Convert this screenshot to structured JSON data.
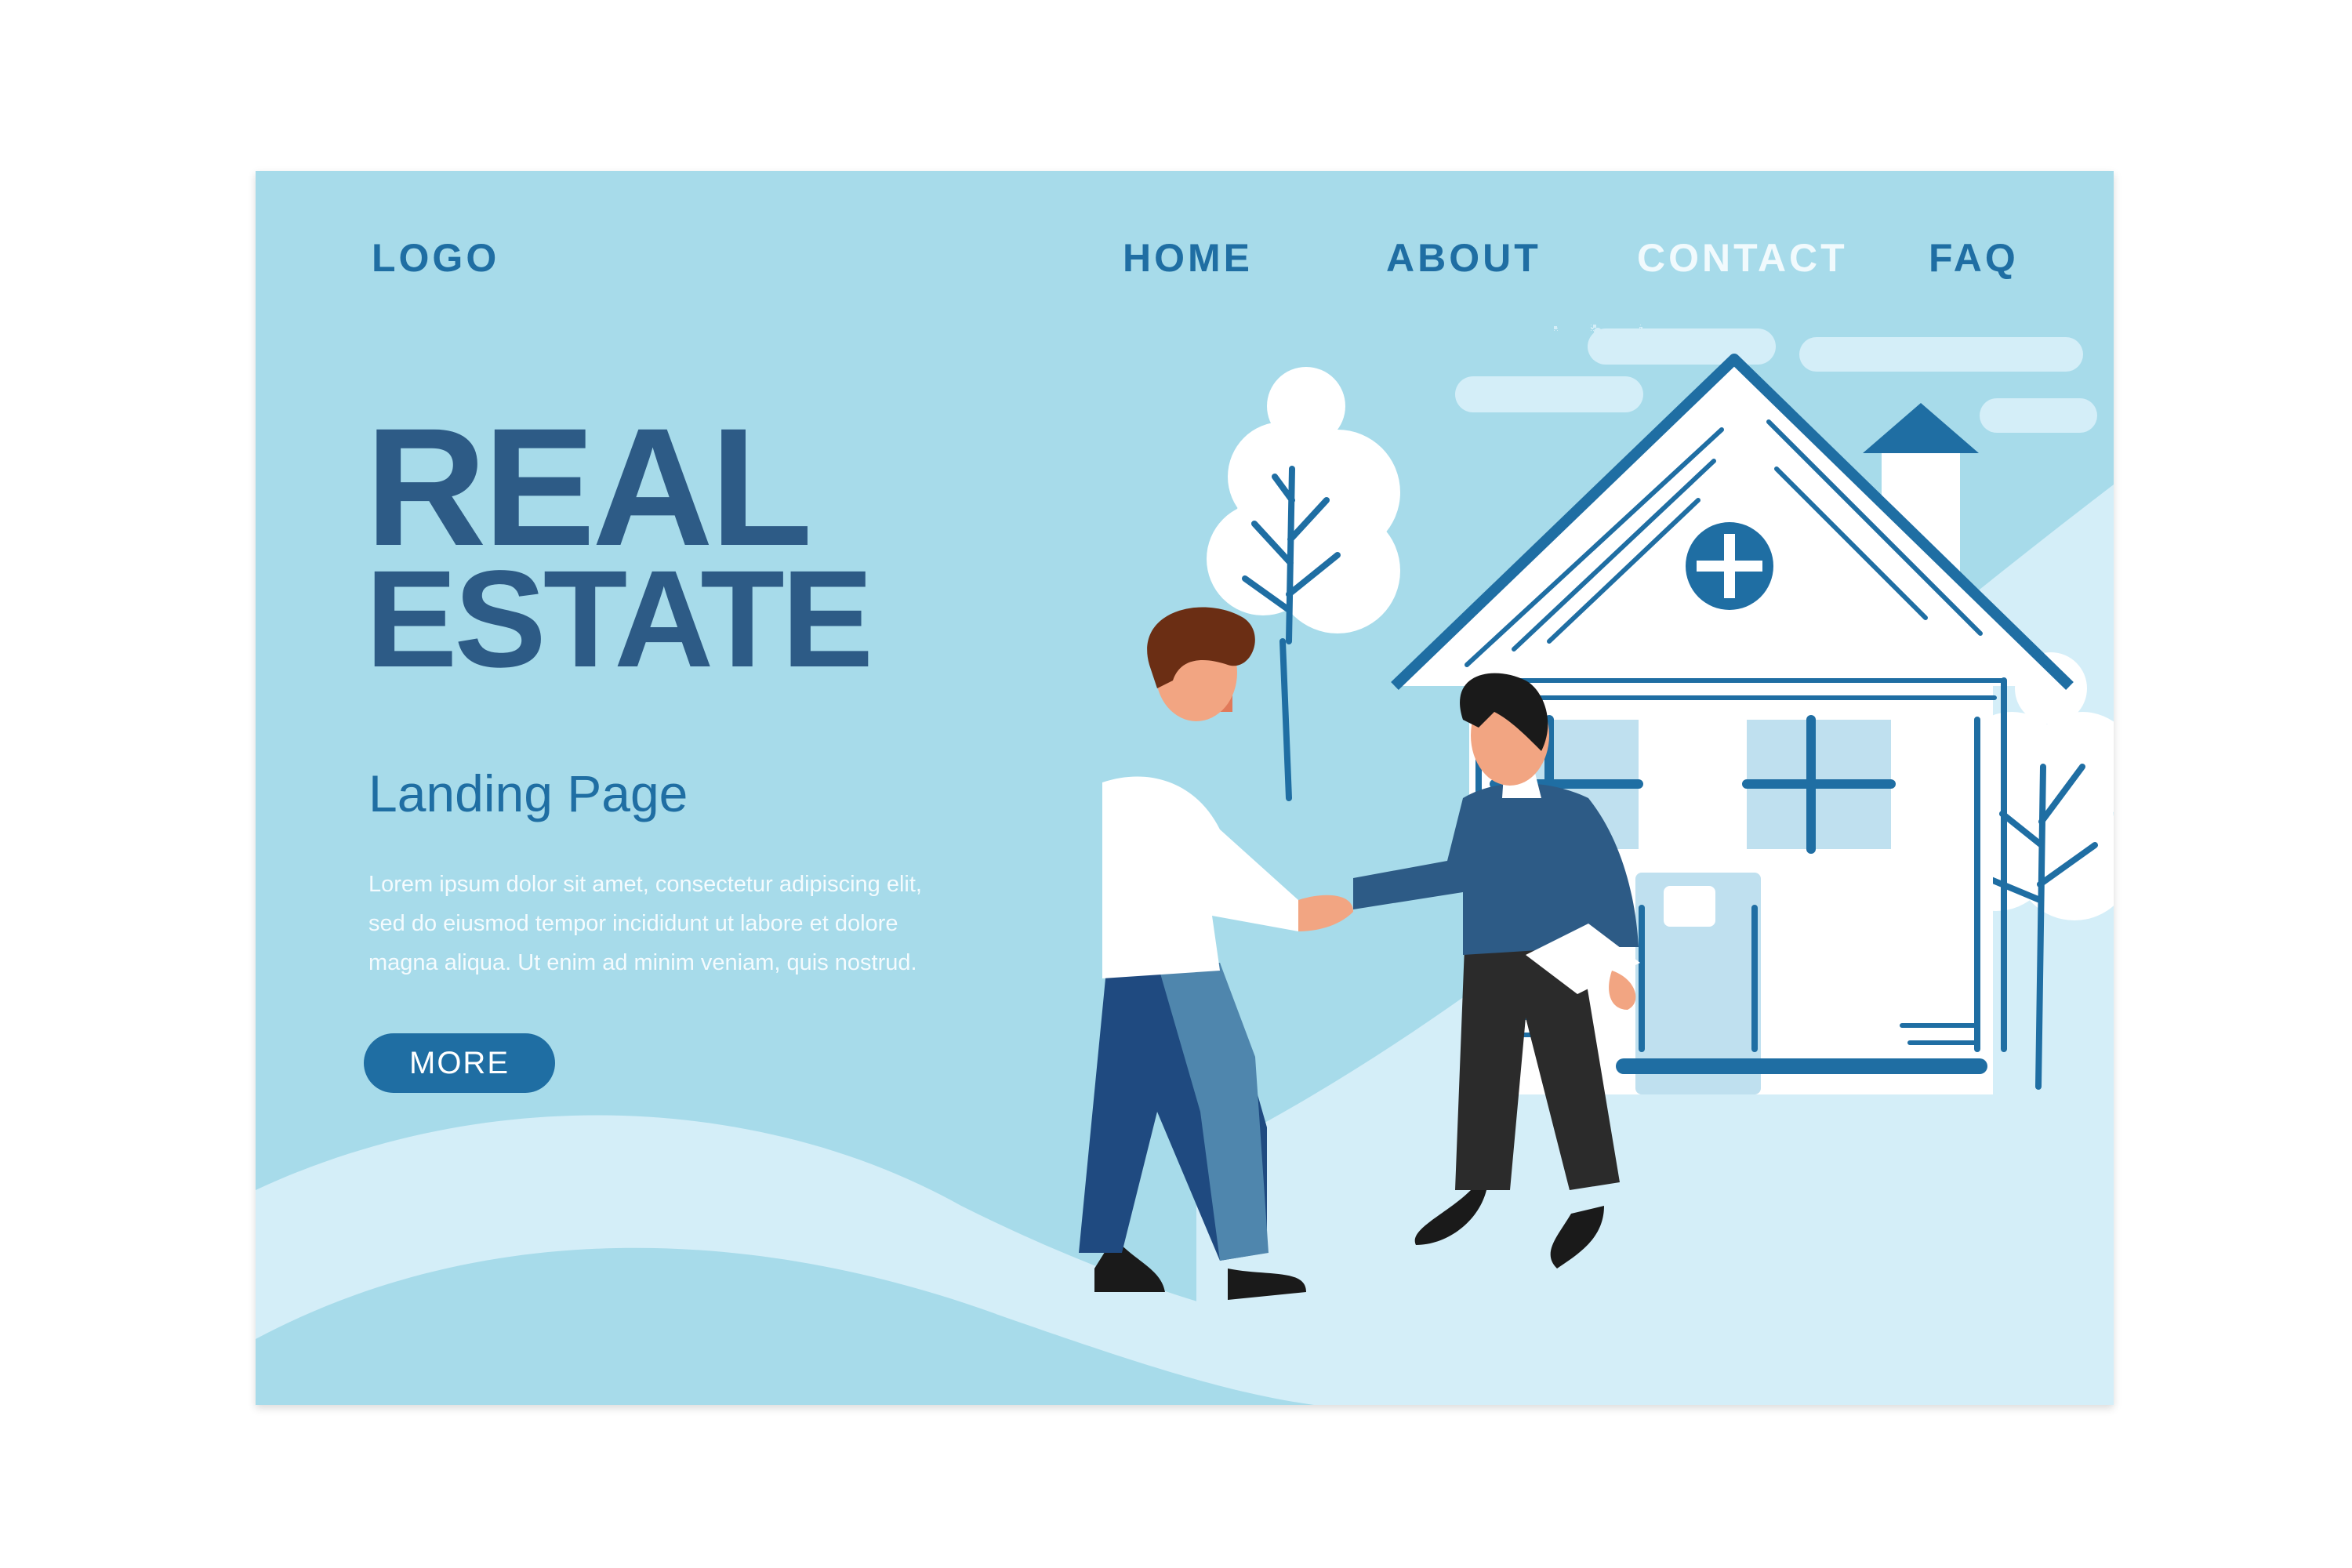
{
  "header": {
    "logo": "LOGO",
    "nav": {
      "home": "HOME",
      "about": "ABOUT",
      "contact": "CONTACT",
      "faq": "FAQ"
    }
  },
  "hero": {
    "title_line1": "REAL",
    "title_line2": "ESTATE",
    "subtitle": "Landing Page",
    "body_line1": "Lorem ipsum dolor sit amet, consectetur adipiscing elit,",
    "body_line2": "sed do eiusmod tempor incididunt ut labore et dolore",
    "body_line3": "magna aliqua.  Ut enim ad minim veniam, quis nostrud.",
    "cta_label": "MORE"
  },
  "colors": {
    "background": "#a7dbea",
    "primary": "#1f6ea3",
    "title": "#2d5b86",
    "light": "#d4eef8"
  },
  "icons": {
    "illustration": "handshake-house-illustration"
  }
}
